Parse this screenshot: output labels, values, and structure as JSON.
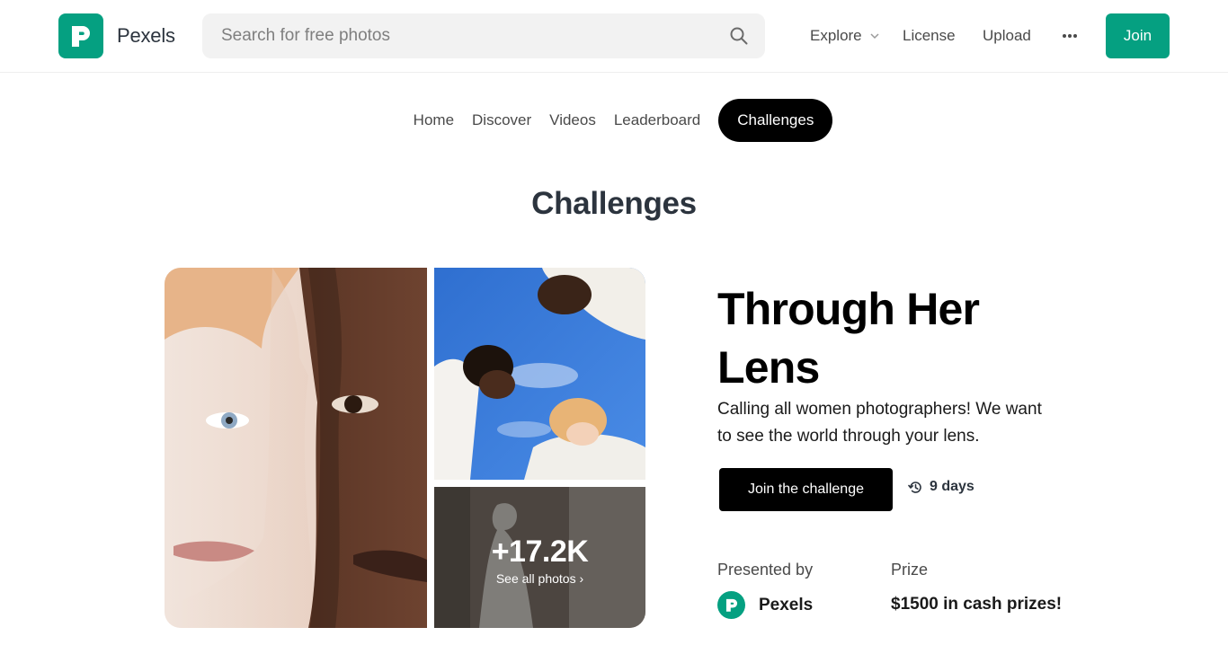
{
  "header": {
    "logo_text": "Pexels",
    "search": {
      "placeholder": "Search for free photos"
    },
    "nav": {
      "explore": "Explore",
      "license": "License",
      "upload": "Upload",
      "more": "•••"
    },
    "join": "Join"
  },
  "tabs": [
    {
      "label": "Home",
      "active": false
    },
    {
      "label": "Discover",
      "active": false
    },
    {
      "label": "Videos",
      "active": false
    },
    {
      "label": "Leaderboard",
      "active": false
    },
    {
      "label": "Challenges",
      "active": true
    }
  ],
  "page_title": "Challenges",
  "challenge": {
    "title": "Through Her Lens",
    "description": "Calling all women photographers! We want to see the world through your lens.",
    "join_button": "Join the challenge",
    "days_left": "9 days",
    "photo_count": "+17.2K",
    "see_all": "See all photos ›",
    "presented_by_label": "Presented by",
    "presenter": "Pexels",
    "prize_label": "Prize",
    "prize": "$1500 in cash prizes!"
  },
  "colors": {
    "brand": "#05a081",
    "active_tab": "#000000",
    "text": "#2c343e"
  },
  "icons": [
    "pexels-logo-icon",
    "search-icon",
    "chevron-down-icon",
    "more-icon",
    "history-icon"
  ]
}
